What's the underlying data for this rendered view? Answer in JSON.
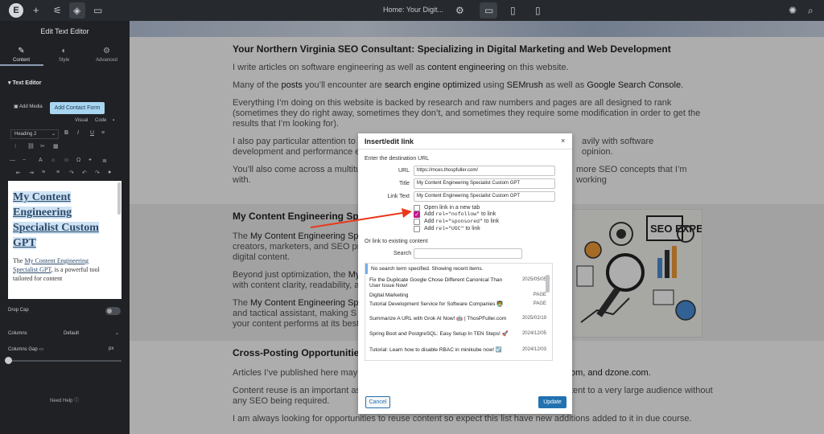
{
  "topbar": {
    "page_title": "Home: Your Digit...",
    "icons": [
      "elementor-logo",
      "plus-icon",
      "sliders-icon",
      "layers-icon",
      "chat-icon",
      "gear-icon",
      "desktop-icon",
      "tablet-icon",
      "mobile-icon",
      "accessibility-icon",
      "search-icon"
    ]
  },
  "panel": {
    "title": "Edit Text Editor",
    "tabs": [
      {
        "label": "Content",
        "icon": "pencil-icon"
      },
      {
        "label": "Style",
        "icon": "half-circle-icon"
      },
      {
        "label": "Advanced",
        "icon": "gear-icon"
      }
    ],
    "section": "Text Editor",
    "add_media": "Add Media",
    "add_contact_form": "Add Contact Form",
    "visual": "Visual",
    "code": "Code",
    "heading_select": "Heading 2",
    "editor": {
      "heading": "My Content Engineering Specialist Custom GPT",
      "para_prefix": "The ",
      "para_link": "My Content Engineering Specialist GPT",
      "para_rest": ", is a powerful tool tailored for content"
    },
    "drop_cap": "Drop Cap",
    "columns": "Columns",
    "columns_value": "Default",
    "columns_gap": "Columns Gap",
    "columns_gap_unit": "px",
    "need_help": "Need Help"
  },
  "page": {
    "h1": "Your Northern Virginia SEO Consultant: Specializing in Digital Marketing and Web Development",
    "p1_a": "I write articles on software engineering as well as ",
    "p1_b": "content engineering",
    "p1_c": " on this website.",
    "p2_a": "Many of the ",
    "p2_b": "posts",
    "p2_c": " you’ll encounter are ",
    "p2_d": "search engine optimized",
    "p2_e": " using ",
    "p2_f": "SEMrush",
    "p2_g": " as well as ",
    "p2_h": "Google Search Console",
    "p2_i": ".",
    "p3": "Everything I’m doing on this website is backed by research and raw numbers and pages are all designed to rank (sometimes they do right away, sometimes they don’t, and sometimes they require some modification in order to get the results that I’m looking for).",
    "p4_left": "I also pay particular attention to ‘",
    "p4_right": "avily with software",
    "p4_left2": "development and performance e",
    "p4_right2": "opinion.",
    "p5_left": "You’ll also come across a multitu",
    "p5_right": "more SEO concepts that I’m working",
    "p5_left2": "with.",
    "h2": "My Content Engineering Speciali",
    "s2_p1_a": "The ",
    "s2_p1_b": "My Content Engineering Spe",
    "s2_p1_l2": "creators, marketers, and SEO pro",
    "s2_p1_l3": "digital content.",
    "s2_p2_a": "Beyond just optimization, the ",
    "s2_p2_b": "My",
    "s2_p2_l2": "with content clarity, readability, a",
    "s2_p3_a": "The ",
    "s2_p3_b": "My Content Engineering Spe",
    "s2_p3_l2": "and tactical assistant, making S",
    "s2_p3_l3": "your content performs at its best",
    "image_text": "SEO EXPERT",
    "h3": "Cross-Posting Opportunities",
    "s3_p1_a": "Articles I’ve published here may c",
    "s3_p1_b": "om",
    "s3_p1_c": ", and ",
    "s3_p1_d": "dzone.com",
    "s3_p1_e": ".",
    "s3_p2_a": "Content reuse is an important as",
    "s3_p2_b": "tent to a very large audience without",
    "s3_p2_l2": "any SEO being required.",
    "s3_p3": "I am always looking for opportunities to reuse content so expect this list have new additions added to it in due course."
  },
  "dialog": {
    "title": "Insert/edit link",
    "close": "×",
    "instruction": "Enter the destination URL",
    "url_label": "URL",
    "url_value": "https://mces.thospfuller.com/",
    "title_label": "Title",
    "title_value": "My Content Engineering Specialist Custom GPT",
    "linktext_label": "Link Text",
    "linktext_value": "My Content Engineering Specialist Custom GPT",
    "options": [
      {
        "pre": "Open link in a new tab",
        "code": "",
        "post": "",
        "checked": false
      },
      {
        "pre": "Add ",
        "code": "rel=\"nofollow\"",
        "post": " to link",
        "checked": true
      },
      {
        "pre": "Add ",
        "code": "rel=\"sponsored\"",
        "post": " to link",
        "checked": false
      },
      {
        "pre": "Add ",
        "code": "rel=\"UGC\"",
        "post": " to link",
        "checked": false
      }
    ],
    "or_link": "Or link to existing content",
    "search_label": "Search",
    "notice": "No search term specified. Showing recent items.",
    "results": [
      {
        "title": "Fix the Duplicate Google Chose Different Canonical Than User Issue Now!",
        "meta": "2025/05/05"
      },
      {
        "title": "Digital Marketing",
        "meta": "PAGE"
      },
      {
        "title": "Tutorial Development Service for Software Companies 👨‍🏫",
        "meta": "PAGE"
      },
      {
        "title": "Summarize A URL with Grok AI Now! 🤖 | ThosPFuller.com",
        "meta": "2025/02/19"
      },
      {
        "title": "Spring Boot and PostgreSQL: Easy Setup In TEN Steps! 🚀",
        "meta": "2024/12/05"
      },
      {
        "title": "Tutorial: Learn how to disable RBAC in minikube now! ☑️",
        "meta": "2024/12/03"
      }
    ],
    "cancel": "Cancel",
    "update": "Update"
  },
  "colors": {
    "accent": "#2271b1",
    "checkbox": "#c4168d",
    "arrow": "#e8391d",
    "panel_bg": "#1f2124",
    "topbar_bg": "#26292e"
  }
}
